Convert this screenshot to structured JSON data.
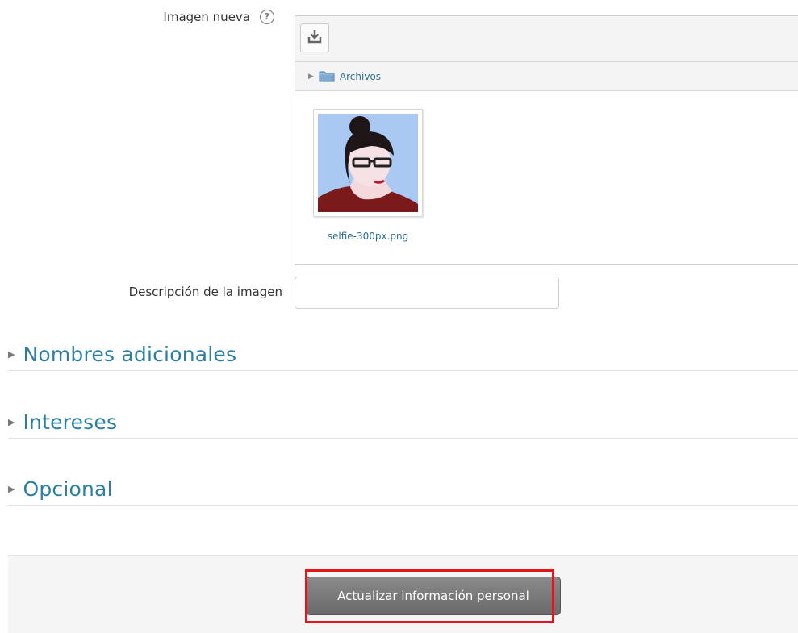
{
  "form": {
    "imagen_nueva_label": "Imagen nueva",
    "help_icon_glyph": "?",
    "descripcion_label": "Descripción de la imagen",
    "descripcion_value": ""
  },
  "filemanager": {
    "folder_label": "Archivos",
    "files": [
      {
        "name": "selfie-300px.png",
        "icon": "avatar-thumbnail"
      }
    ],
    "download_icon": "download-icon"
  },
  "sections": [
    {
      "title": "Nombres adicionales"
    },
    {
      "title": "Intereses"
    },
    {
      "title": "Opcional"
    }
  ],
  "footer": {
    "submit_label": "Actualizar información personal"
  },
  "colors": {
    "link": "#2a6f8f",
    "section_title": "#2a7fa3",
    "highlight": "#e0161b",
    "button": "#777777"
  }
}
